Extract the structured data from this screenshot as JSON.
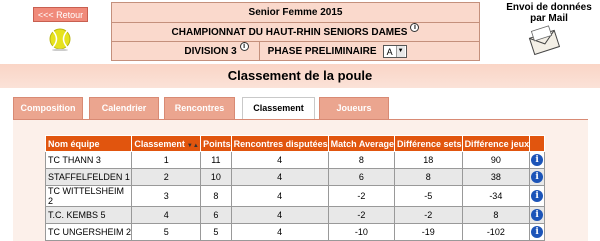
{
  "back_label": "<<< Retour",
  "header": {
    "line1": "Senior Femme  2015",
    "line2": "CHAMPIONNAT DU HAUT-RHIN SENIORS DAMES",
    "division": "DIVISION 3",
    "phase": "PHASE PRELIMINAIRE",
    "poule_value": "A",
    "info_glyph": "i"
  },
  "mail": {
    "line1": "Envoi de données",
    "line2": "par Mail"
  },
  "page_title": "Classement de la poule",
  "tabs": [
    {
      "label": "Composition",
      "active": false
    },
    {
      "label": "Calendrier",
      "active": false
    },
    {
      "label": "Rencontres",
      "active": false
    },
    {
      "label": "Classement",
      "active": true
    },
    {
      "label": "Joueurs",
      "active": false
    }
  ],
  "table": {
    "headers": [
      "Nom équipe",
      "Classement",
      "Points",
      "Rencontres disputées",
      "Match Average",
      "Différence sets",
      "Différence jeux"
    ],
    "rows": [
      {
        "team": "TC THANN 3",
        "rank": "1",
        "points": "11",
        "played": "4",
        "avg": "8",
        "sets": "18",
        "games": "90"
      },
      {
        "team": "STAFFELFELDEN 1",
        "rank": "2",
        "points": "10",
        "played": "4",
        "avg": "6",
        "sets": "8",
        "games": "38"
      },
      {
        "team": "TC WITTELSHEIM 2",
        "rank": "3",
        "points": "8",
        "played": "4",
        "avg": "-2",
        "sets": "-5",
        "games": "-34"
      },
      {
        "team": "T.C. KEMBS 5",
        "rank": "4",
        "points": "6",
        "played": "4",
        "avg": "-2",
        "sets": "-2",
        "games": "8"
      },
      {
        "team": "TC UNGERSHEIM 2",
        "rank": "5",
        "points": "5",
        "played": "4",
        "avg": "-10",
        "sets": "-19",
        "games": "-102"
      }
    ]
  },
  "colors": {
    "accent": "#e1550e",
    "tab": "#eba58f",
    "header_bg": "#fad9cc",
    "info_blue": "#1c54b8"
  },
  "icons": [
    "tennis-ball-icon",
    "info-icon",
    "sort-icon",
    "envelope-icon"
  ]
}
